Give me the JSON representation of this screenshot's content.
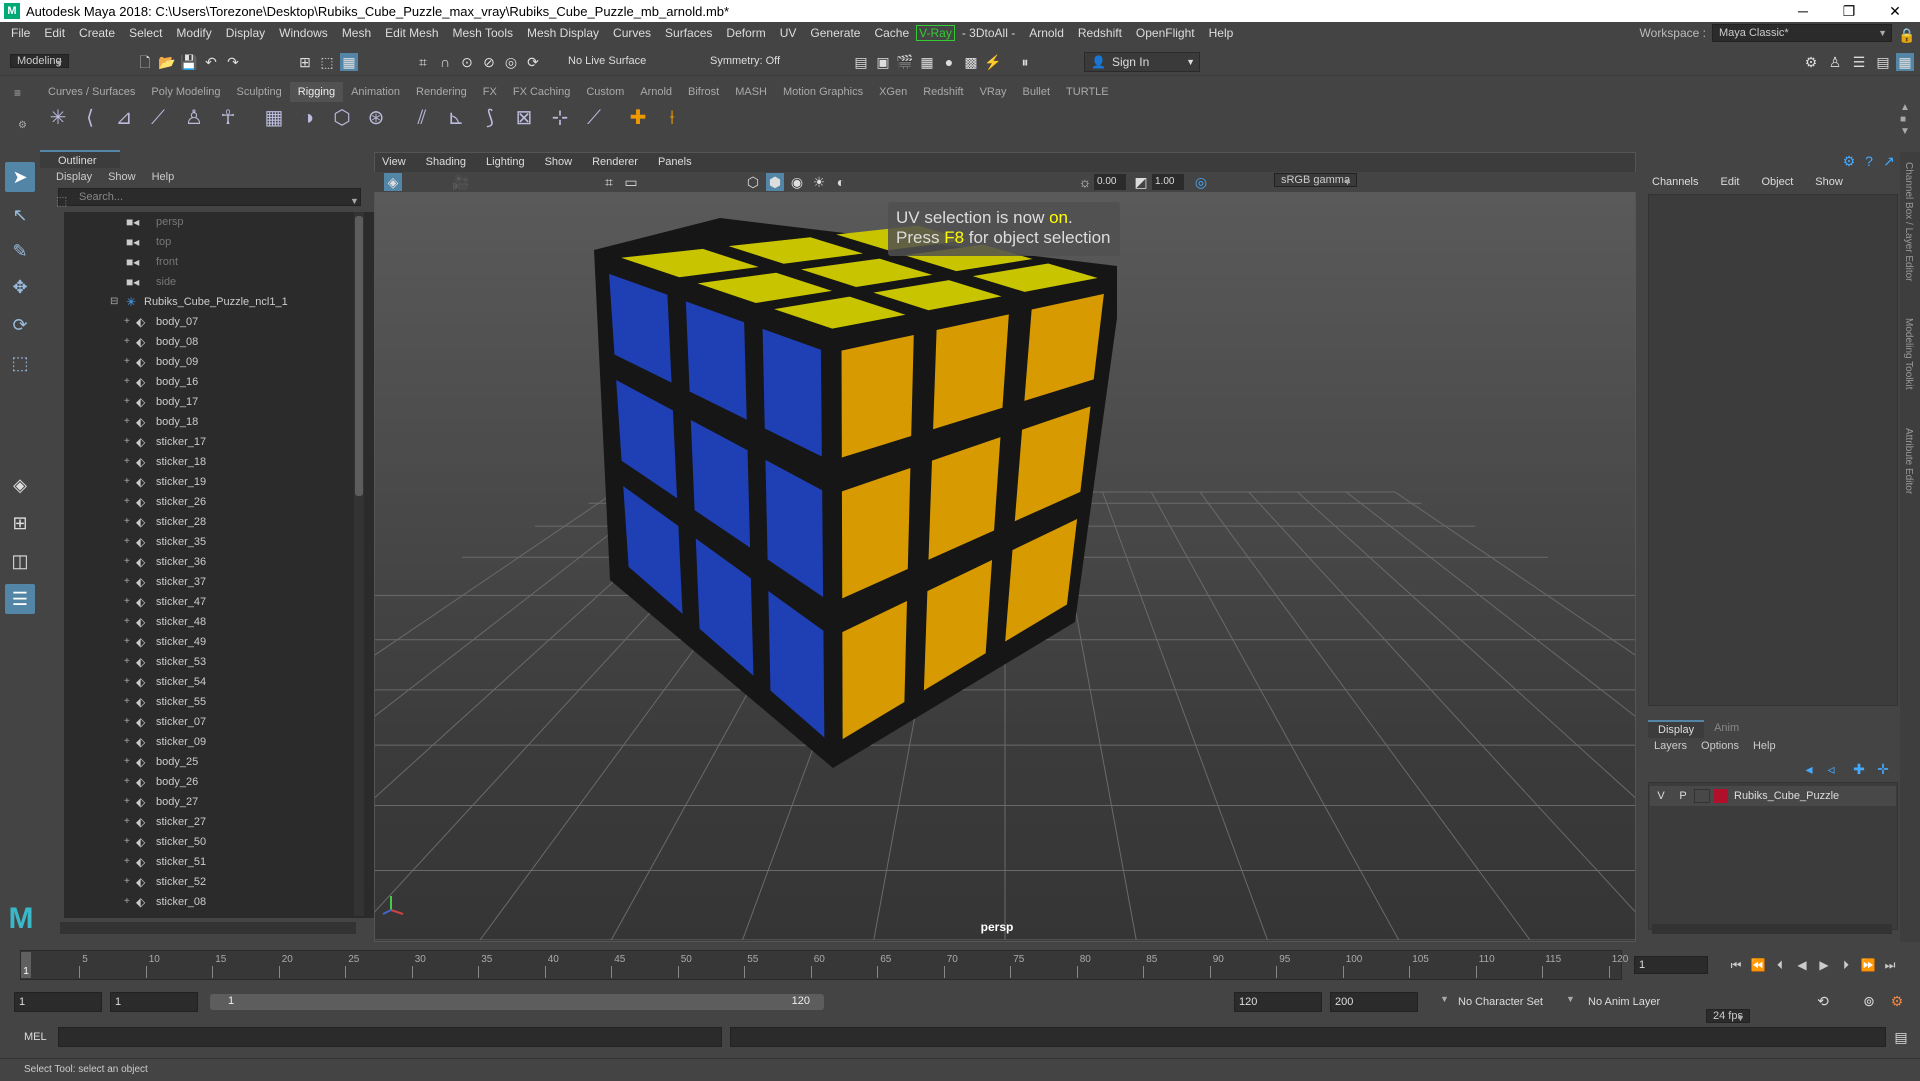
{
  "window": {
    "title": "Autodesk Maya 2018: C:\\Users\\Torezone\\Desktop\\Rubiks_Cube_Puzzle_max_vray\\Rubiks_Cube_Puzzle_mb_arnold.mb*",
    "app_icon": "M"
  },
  "menubar": {
    "items": [
      "File",
      "Edit",
      "Create",
      "Select",
      "Modify",
      "Display",
      "Windows",
      "Mesh",
      "Edit Mesh",
      "Mesh Tools",
      "Mesh Display",
      "Curves",
      "Surfaces",
      "Deform",
      "UV",
      "Generate",
      "Cache",
      "V-Ray",
      "- 3DtoAll -",
      "Arnold",
      "Redshift",
      "OpenFlight",
      "Help"
    ],
    "workspace_label": "Workspace :",
    "workspace_value": "Maya Classic*"
  },
  "statusline": {
    "mode": "Modeling",
    "live_surface": "No Live Surface",
    "symmetry": "Symmetry: Off",
    "sign_in": "Sign In"
  },
  "shelf": {
    "tabs": [
      "Curves / Surfaces",
      "Poly Modeling",
      "Sculpting",
      "Rigging",
      "Animation",
      "Rendering",
      "FX",
      "FX Caching",
      "Custom",
      "Arnold",
      "Bifrost",
      "MASH",
      "Motion Graphics",
      "XGen",
      "Redshift",
      "VRay",
      "Bullet",
      "TURTLE"
    ],
    "active_tab": "Rigging"
  },
  "outliner": {
    "title": "Outliner",
    "menu": [
      "Display",
      "Show",
      "Help"
    ],
    "search_placeholder": "Search...",
    "cameras": [
      "persp",
      "top",
      "front",
      "side"
    ],
    "group": "Rubiks_Cube_Puzzle_ncl1_1",
    "items": [
      "body_07",
      "body_08",
      "body_09",
      "body_16",
      "body_17",
      "body_18",
      "sticker_17",
      "sticker_18",
      "sticker_19",
      "sticker_26",
      "sticker_28",
      "sticker_35",
      "sticker_36",
      "sticker_37",
      "sticker_47",
      "sticker_48",
      "sticker_49",
      "sticker_53",
      "sticker_54",
      "sticker_55",
      "sticker_07",
      "sticker_09",
      "body_25",
      "body_26",
      "body_27",
      "sticker_27",
      "sticker_50",
      "sticker_51",
      "sticker_52",
      "sticker_08"
    ]
  },
  "viewport": {
    "menu": [
      "View",
      "Shading",
      "Lighting",
      "Show",
      "Renderer",
      "Panels"
    ],
    "exposure": "0.00",
    "gamma": "1.00",
    "color_space": "sRGB gamma",
    "message_line1_a": "UV selection is now ",
    "message_line1_on": "on",
    "message_line1_b": ".",
    "message_line2_a": "Press ",
    "message_line2_key": "F8",
    "message_line2_b": " for object selection",
    "camera_label": "persp",
    "cube_colors": {
      "top": "#c8c400",
      "left": "#1f3fb5",
      "right": "#d79a00",
      "body": "#161616"
    }
  },
  "channelbox": {
    "menu": [
      "Channels",
      "Edit",
      "Object",
      "Show"
    ],
    "layer_tabs": [
      "Display",
      "Anim"
    ],
    "layer_menu": [
      "Layers",
      "Options",
      "Help"
    ],
    "layer_v": "V",
    "layer_p": "P",
    "layer_name": "Rubiks_Cube_Puzzle",
    "layer_color": "#b0102a",
    "side_tabs": [
      "Channel Box / Layer Editor",
      "Modeling Toolkit",
      "Attribute Editor"
    ]
  },
  "timeline": {
    "ticks": [
      "5",
      "10",
      "15",
      "20",
      "25",
      "30",
      "35",
      "40",
      "45",
      "50",
      "55",
      "60",
      "65",
      "70",
      "75",
      "80",
      "85",
      "90",
      "95",
      "100",
      "105",
      "110",
      "115",
      "120"
    ],
    "first_tick": "1",
    "current_frame": "1"
  },
  "range": {
    "start": "1",
    "playback_start": "1",
    "slider_start": "1",
    "slider_end": "120",
    "playback_end": "120",
    "end": "200",
    "character_set": "No Character Set",
    "anim_layer": "No Anim Layer",
    "fps": "24 fps"
  },
  "cmdline": {
    "label": "MEL"
  },
  "helpline": {
    "text": "Select Tool: select an object"
  }
}
